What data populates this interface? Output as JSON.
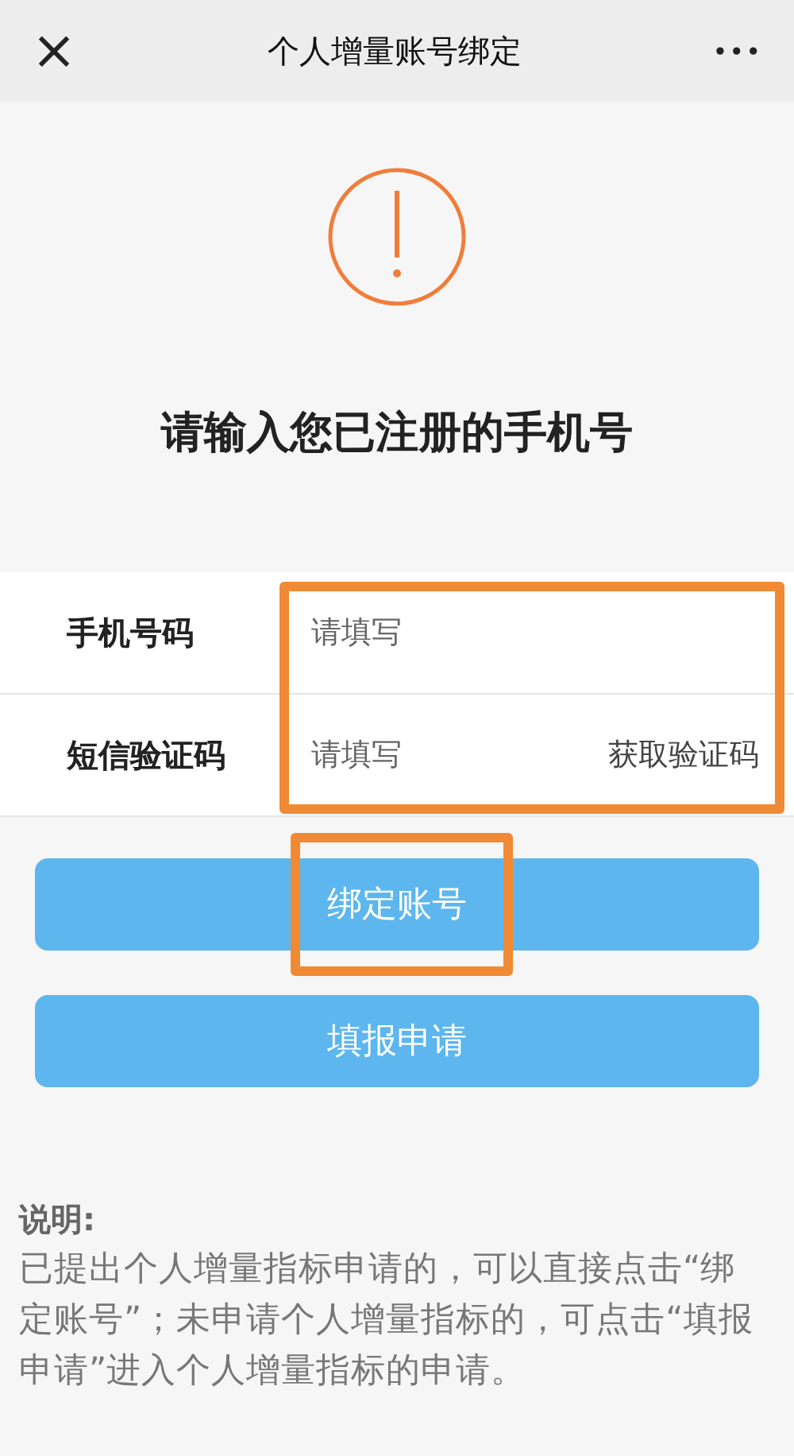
{
  "header": {
    "close": "×",
    "title": "个人增量账号绑定",
    "more": "•••"
  },
  "heading": "请输入您已注册的手机号",
  "form": [
    {
      "kind": "input",
      "label": "手机号码",
      "placeholder": "请填写"
    },
    {
      "kind": "code",
      "label": "短信验证码",
      "placeholder": "请填写",
      "action": "获取验证码"
    }
  ],
  "buttons": [
    "绑定账号",
    "填报申请"
  ],
  "note": {
    "title": "说明:",
    "text": "已提出个人增量指标申请的，可以直接点击“绑定账号”；未申请个人增量指标的，可点击“填报申请”进入个人增量指标的申请。"
  }
}
